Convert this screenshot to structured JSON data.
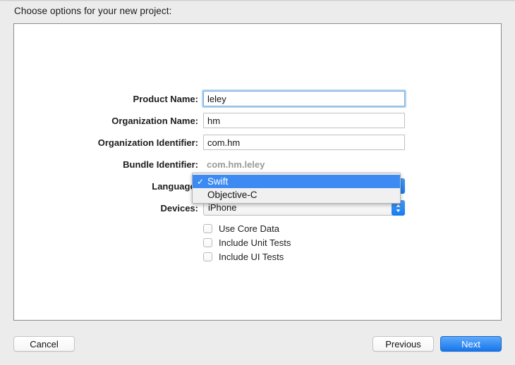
{
  "dialog": {
    "prompt": "Choose options for your new project:"
  },
  "form": {
    "fields": [
      {
        "label": "Product Name:",
        "value": "leley",
        "type": "text",
        "focused": true
      },
      {
        "label": "Organization Name:",
        "value": "hm",
        "type": "text",
        "focused": false
      },
      {
        "label": "Organization Identifier:",
        "value": "com.hm",
        "type": "text",
        "focused": false
      },
      {
        "label": "Bundle Identifier:",
        "value": "com.hm.leley",
        "type": "static",
        "focused": false
      }
    ],
    "language": {
      "label": "Language:",
      "value": "Swift"
    },
    "devices": {
      "label": "Devices:",
      "value": "iPhone"
    },
    "checkboxes": [
      {
        "label": "Use Core Data",
        "checked": false
      },
      {
        "label": "Include Unit Tests",
        "checked": false
      },
      {
        "label": "Include UI Tests",
        "checked": false
      }
    ]
  },
  "language_menu": {
    "open": true,
    "check_glyph": "✓",
    "items": [
      {
        "label": "Swift",
        "selected": true,
        "checked": true
      },
      {
        "label": "Objective-C",
        "selected": false,
        "checked": false
      }
    ]
  },
  "footer": {
    "cancel_label": "Cancel",
    "previous_label": "Previous",
    "next_label": "Next"
  },
  "colors": {
    "accent_blue": "#3d8bf2",
    "default_button_blue": "#1577ee",
    "focus_ring": "#7aaee0",
    "window_bg": "#ececec",
    "panel_bg": "#ffffff",
    "static_text": "#9a9a9a"
  }
}
